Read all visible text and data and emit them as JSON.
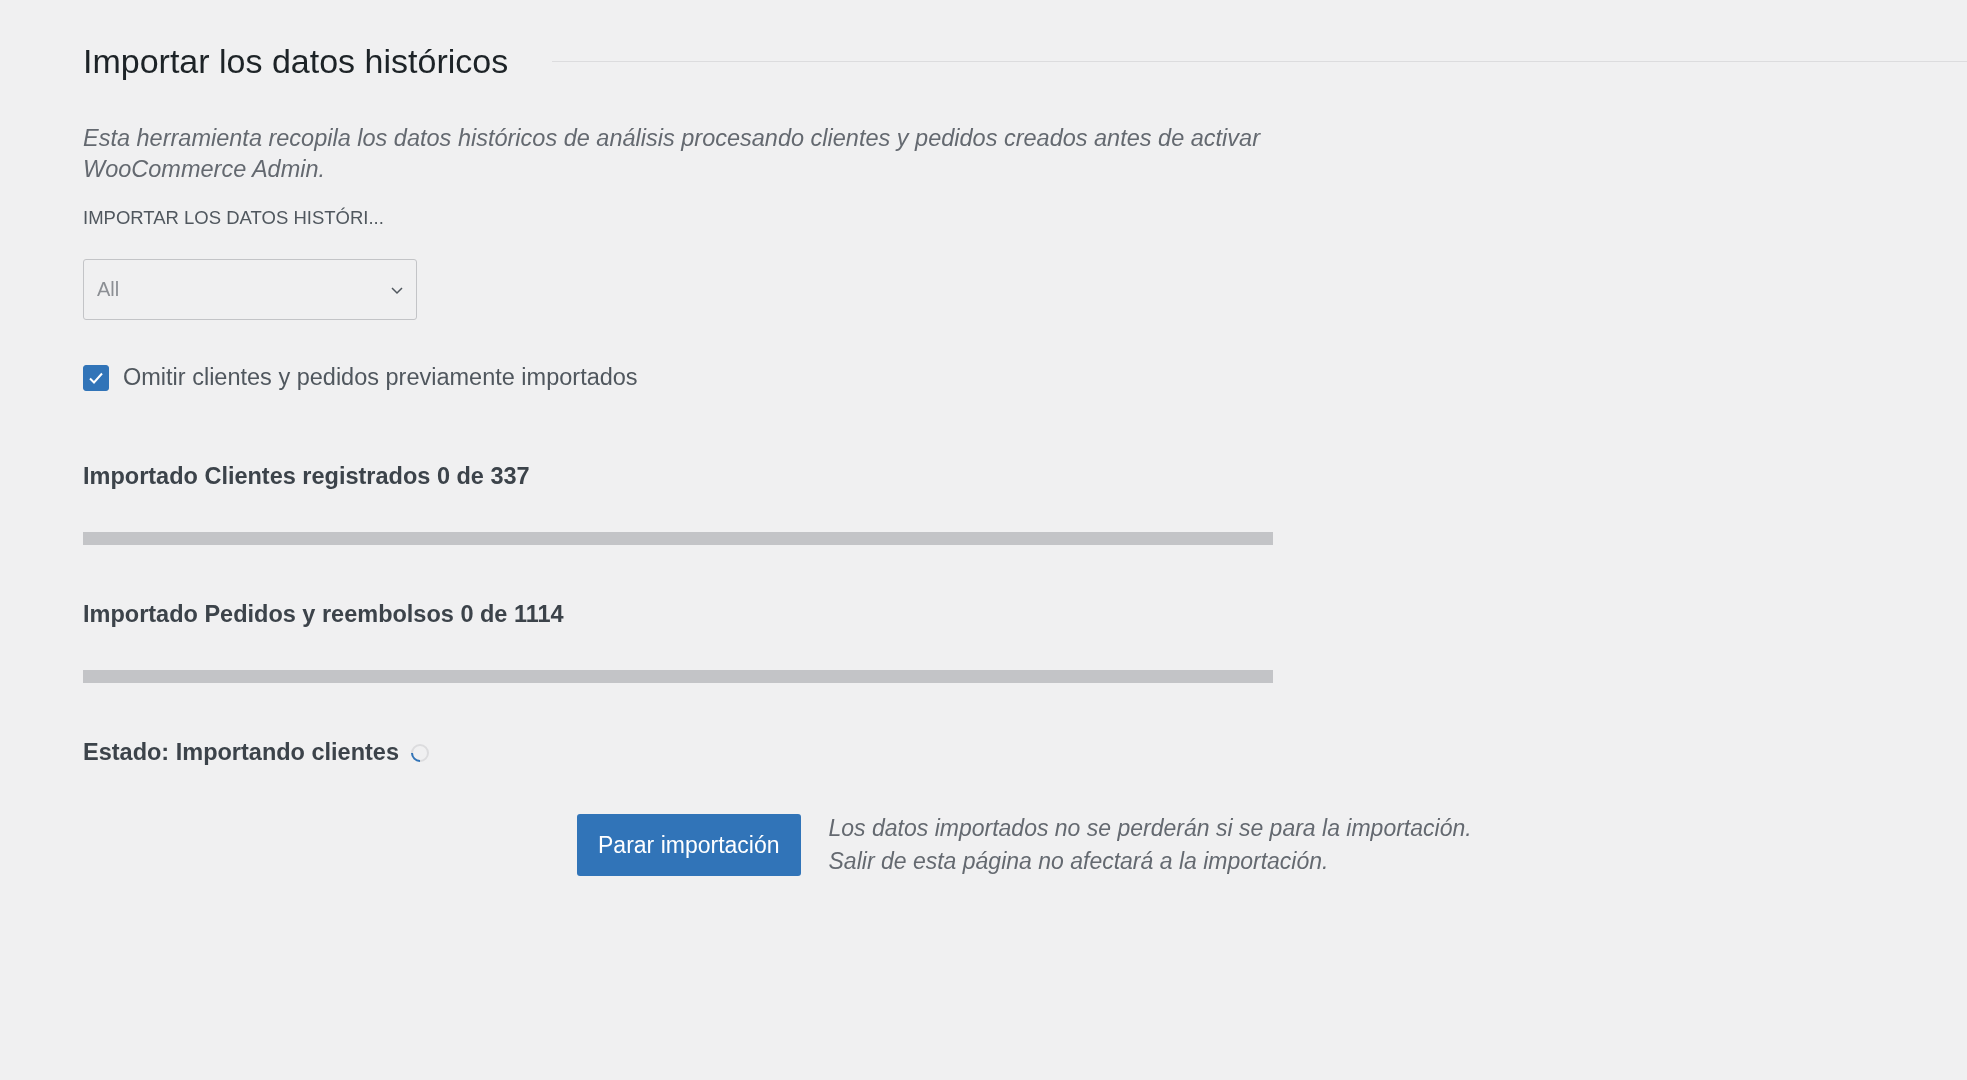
{
  "section": {
    "title": "Importar los datos históricos"
  },
  "description": "Esta herramienta recopila los datos históricos de análisis procesando clientes y pedidos creados antes de activar WooCommerce Admin.",
  "period": {
    "label": "IMPORTAR LOS DATOS HISTÓRI...",
    "value": "All"
  },
  "skip_checkbox": {
    "label": "Omitir clientes y pedidos previamente importados",
    "checked": true
  },
  "progress": [
    {
      "title": "Importado Clientes registrados 0 de 337",
      "level": 0
    },
    {
      "title": "Importado Pedidos y reembolsos 0 de 1114",
      "level": 0
    }
  ],
  "status": {
    "text": "Estado: Importando clientes",
    "loading": true
  },
  "stop_button": "Parar importación",
  "note_lines": [
    "Los datos importados no se perderán si se para la importación.",
    "Salir de esta página no afectará a la importación."
  ]
}
